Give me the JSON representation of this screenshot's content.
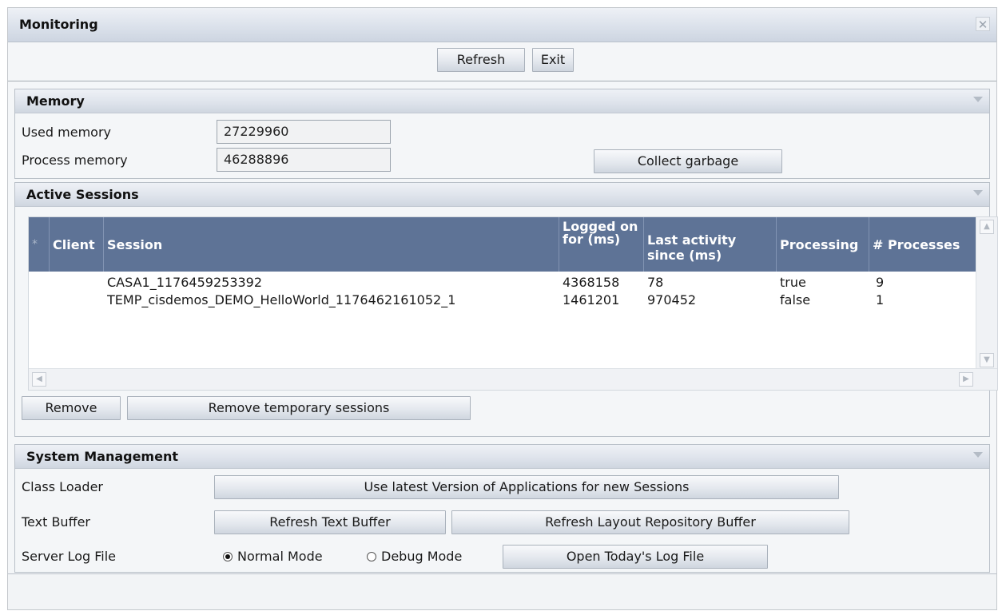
{
  "window": {
    "title": "Monitoring"
  },
  "toolbar": {
    "refresh_label": "Refresh",
    "exit_label": "Exit"
  },
  "memory": {
    "title": "Memory",
    "used_label": "Used memory",
    "used_value": "27229960",
    "process_label": "Process memory",
    "process_value": "46288896",
    "collect_label": "Collect garbage"
  },
  "sessions": {
    "title": "Active Sessions",
    "columns": {
      "select": "*",
      "client": "Client",
      "session": "Session",
      "logged": "Logged on for (ms)",
      "last": "Last activity since (ms)",
      "processing": "Processing",
      "processes": "# Processes"
    },
    "rows": [
      {
        "client": "",
        "session": "CASA1_1176459253392",
        "logged": "4368158",
        "last": "78",
        "processing": "true",
        "processes": "9"
      },
      {
        "client": "",
        "session": "TEMP_cisdemos_DEMO_HelloWorld_1176462161052_1",
        "logged": "1461201",
        "last": "970452",
        "processing": "false",
        "processes": "1"
      }
    ],
    "remove_label": "Remove",
    "remove_temp_label": "Remove temporary sessions"
  },
  "system": {
    "title": "System Management",
    "class_loader_label": "Class Loader",
    "class_loader_button": "Use latest Version of Applications for new Sessions",
    "text_buffer_label": "Text Buffer",
    "refresh_text_button": "Refresh Text Buffer",
    "refresh_layout_button": "Refresh Layout Repository Buffer",
    "log_label": "Server Log File",
    "normal_mode": "Normal Mode",
    "debug_mode": "Debug Mode",
    "log_mode_selected": "Normal Mode",
    "open_log_button": "Open Today's Log File"
  },
  "icons": {
    "close": "close-icon",
    "collapse": "chevron-down-icon",
    "scroll_up": "arrow-up-icon",
    "scroll_down": "arrow-down-icon",
    "scroll_left": "arrow-left-icon",
    "scroll_right": "arrow-right-icon"
  }
}
